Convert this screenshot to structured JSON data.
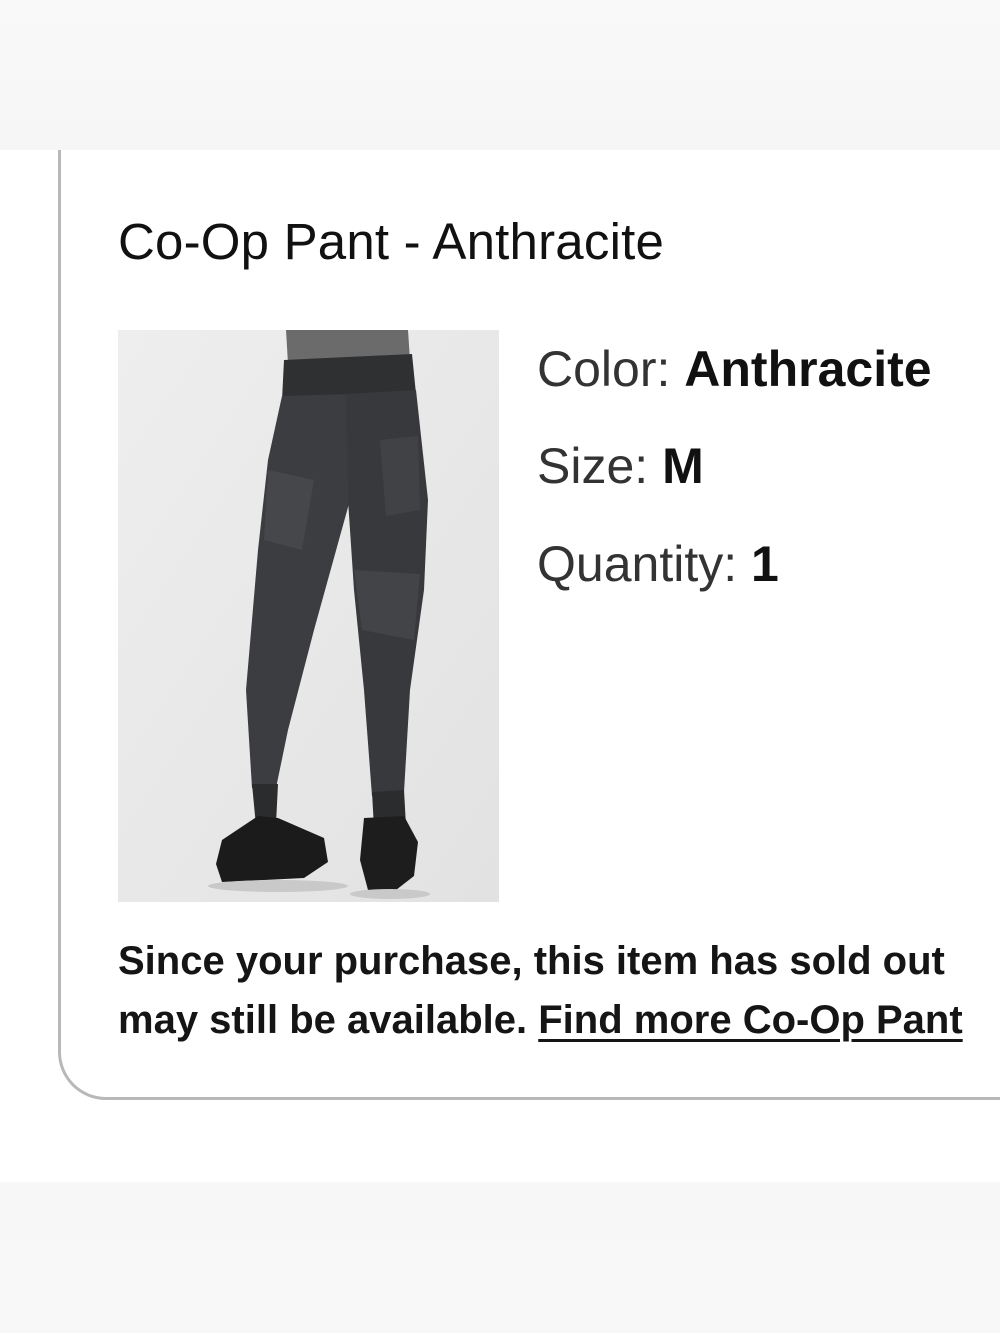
{
  "product": {
    "title": "Co-Op Pant - Anthracite",
    "image_alt": "Co-Op Pant - Anthracite",
    "color_label": "Color:",
    "color_value": "Anthracite",
    "size_label": "Size:",
    "size_value": "M",
    "quantity_label": "Quantity:",
    "quantity_value": "1"
  },
  "notice": {
    "line1": "Since your purchase, this item has sold out",
    "line2_prefix": "may still be available.",
    "link_text": "Find more Co-Op Pant"
  },
  "colors": {
    "card_border": "#b8b8b8",
    "text": "#111111",
    "image_bg": "#e7e7e7"
  }
}
